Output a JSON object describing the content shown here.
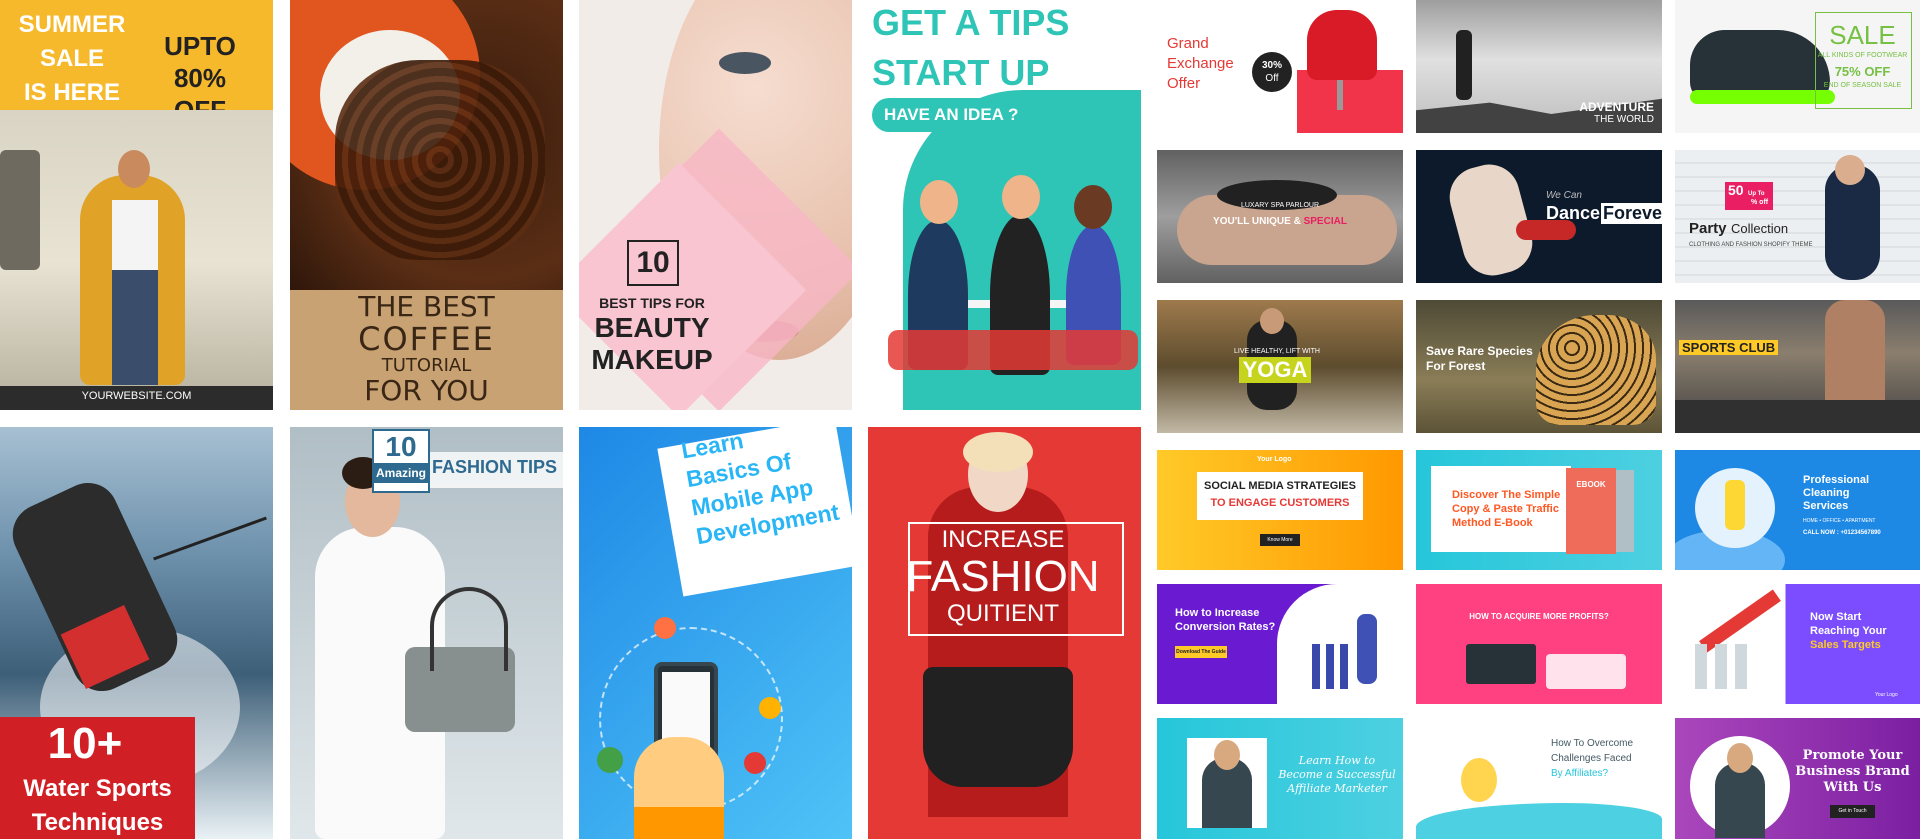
{
  "colors": {
    "yellow": "#f7b92c",
    "pink": "#f9c5d1",
    "teal": "#2ec4b6",
    "red": "#e53935",
    "blue": "#29b6f6",
    "purple": "#7c4dff"
  },
  "tiles": {
    "summer_sale": {
      "headline_lines": [
        "SUMMER",
        "SALE",
        "IS HERE"
      ],
      "offer_lines": [
        "UPTO 80%",
        "OFF"
      ],
      "website": "YOURWEBSITE.COM"
    },
    "coffee": {
      "lines": [
        "THE BEST",
        "COFFEE",
        "TUTORIAL",
        "FOR YOU"
      ]
    },
    "beauty": {
      "number": "10",
      "subtitle": "BEST TIPS FOR",
      "title_lines": [
        "BEAUTY",
        "MAKEUP"
      ]
    },
    "tips_startup": {
      "lines": [
        "GET A TIPS",
        "START UP"
      ],
      "pill": "HAVE AN IDEA ?"
    },
    "water_sports": {
      "number": "10+",
      "lines": [
        "Water Sports",
        "Techniques"
      ]
    },
    "fashion_tips": {
      "number": "10",
      "amazing": "Amazing",
      "title": "FASHION TIPS"
    },
    "mobile_app": {
      "lines": [
        "Learn",
        "Basics Of",
        "Mobile App",
        "Development"
      ]
    },
    "fashion_quotient": {
      "lines": [
        "INCREASE",
        "FASHION",
        "QUITIENT"
      ]
    },
    "grand_exchange": {
      "lines": [
        "Grand",
        "Exchange",
        "Offer"
      ],
      "badge_pct": "30%",
      "badge_off": "Off"
    },
    "adventure": {
      "title": "ADVENTURE",
      "sub": "THE WORLD"
    },
    "footwear": {
      "sale": "SALE",
      "kinds": "ALL KINDS OF FOOTWEAR",
      "pct": "75% OFF",
      "end": "END OF SEASON SALE"
    },
    "spa": {
      "small": "LUXARY SPA PARLOUR",
      "main": "YOU'LL UNIQUE &",
      "accent": "SPECIAL"
    },
    "dance": {
      "we_can": "We Can",
      "dance": "Dance",
      "forever": "Forever"
    },
    "party": {
      "num": "50",
      "upto": "Up To",
      "off": "% off",
      "party": "Party",
      "collection": "Collection",
      "sub": "CLOTHING AND FASHION SHOPIFY THEME"
    },
    "yoga": {
      "small": "LIVE HEALTHY, LIFT WITH",
      "title": "YOGA"
    },
    "species": {
      "line1": "Save Rare Species",
      "line2": "For Forest"
    },
    "sports_club": {
      "title": "SPORTS CLUB"
    },
    "social_media": {
      "logo": "Your Logo",
      "line1": "SOCIAL MEDIA STRATEGIES",
      "line2": "TO ENGAGE CUSTOMERS",
      "button": "Know More"
    },
    "ebook": {
      "lines": [
        "Discover The Simple",
        "Copy & Paste Traffic",
        "Method E-Book"
      ],
      "book": "EBOOK"
    },
    "cleaning": {
      "lines": [
        "Professional",
        "Cleaning",
        "Services"
      ],
      "sub": "HOME  •  OFFICE  •  APARTMENT",
      "call": "CALL NOW : +01234567890"
    },
    "conversion": {
      "lines": [
        "How to Increase",
        "Conversion Rates?"
      ],
      "button": "Download The Guide"
    },
    "profits": {
      "title": "HOW TO ACQUIRE MORE PROFITS?"
    },
    "sales_targets": {
      "lines": [
        "Now Start",
        "Reaching Your"
      ],
      "accent": "Sales Targets",
      "logo": "Your Logo"
    },
    "affiliate_marketer": {
      "lines": [
        "Learn How to",
        "Become a Successful",
        "Affiliate Marketer"
      ]
    },
    "affiliates": {
      "lines": [
        "How To Overcome",
        "Challenges Faced"
      ],
      "accent": "By Affiliates?"
    },
    "promote": {
      "lines": [
        "Promote Your",
        "Business Brand",
        "With Us"
      ],
      "button": "Get in Touch"
    }
  }
}
